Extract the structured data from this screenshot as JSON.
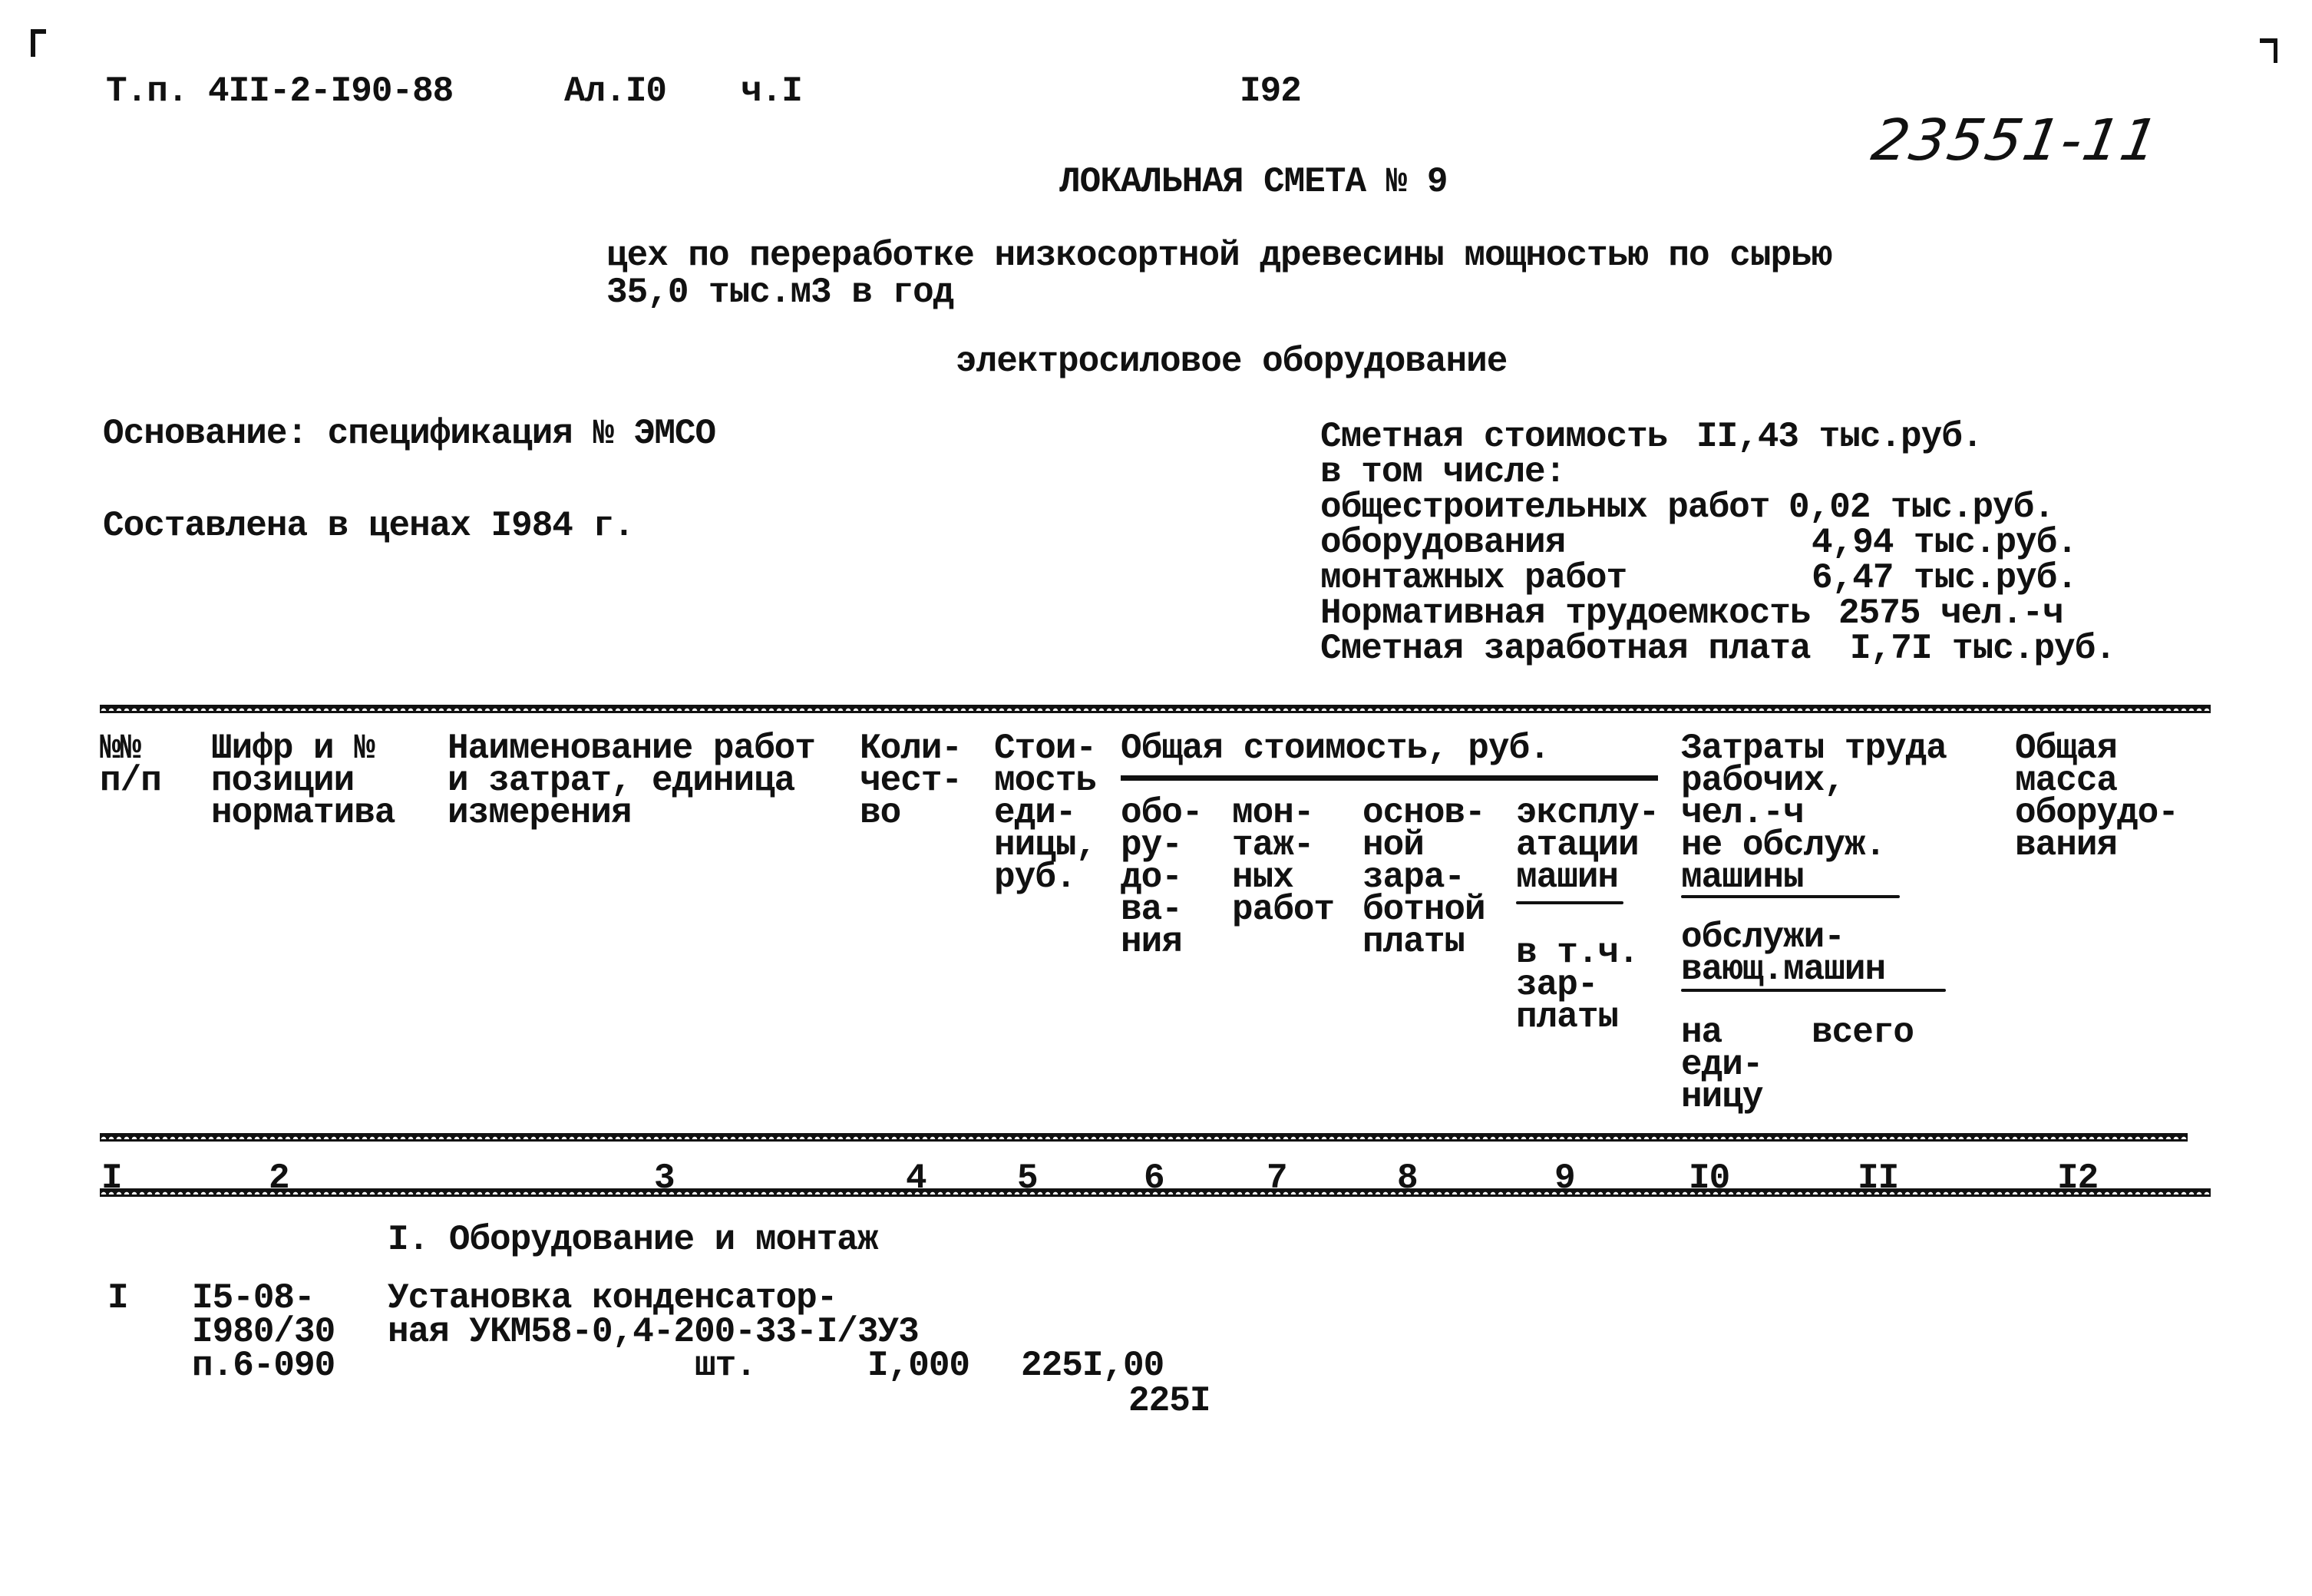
{
  "header": {
    "project_code": "Т.п. 4II-2-I90-88",
    "album": "Ал.I0",
    "part": "ч.I",
    "page_number": "I92",
    "stamp_number": "23551-11",
    "title": "ЛОКАЛЬНАЯ СМЕТА № 9",
    "object_line1": "цех по переработке низкосортной древесины мощностью по сырью",
    "object_line2": "35,0 тыс.м3 в год",
    "subtitle": "электросиловое оборудование"
  },
  "basis": {
    "basis_text": "Основание: спецификация № ЭМСО",
    "prices_text": "Составлена в ценах I984 г."
  },
  "summary": {
    "total_label": "Сметная стоимость",
    "total_value": "II,43 тыс.руб.",
    "including_label": "в том числе:",
    "rows": [
      {
        "label": "общестроительных работ",
        "value": "0,02 тыс.руб."
      },
      {
        "label": "оборудования",
        "value": "4,94 тыс.руб."
      },
      {
        "label": "монтажных работ",
        "value": "6,47 тыс.руб."
      }
    ],
    "labor_label": "Нормативная трудоемкость",
    "labor_value": "2575 чел.-ч",
    "wage_label": "Сметная заработная плата",
    "wage_value": "I,7I тыс.руб."
  },
  "table": {
    "headers": {
      "c1": [
        "№№",
        "п/п"
      ],
      "c2": [
        "Шифр и №",
        "позиции",
        "норматива"
      ],
      "c3": [
        "Наименование работ",
        "и затрат, единица",
        "измерения"
      ],
      "c4": [
        "Коли-",
        "чест-",
        "во"
      ],
      "c5": [
        "Стои-",
        "мость",
        "еди-",
        "ницы,",
        "руб."
      ],
      "group_total": "Общая стоимость, руб.",
      "c6": [
        "обо-",
        "ру-",
        "до-",
        "ва-",
        "ния"
      ],
      "c7": [
        "мон-",
        "таж-",
        "ных",
        "работ"
      ],
      "c8": [
        "основ-",
        "ной",
        "зара-",
        "ботной",
        "платы"
      ],
      "c9_top": [
        "эксплу-",
        "атации",
        "машин"
      ],
      "c9_bottom": [
        "в т.ч.",
        "зар-",
        "платы"
      ],
      "group_labor": [
        "Затраты труда",
        "рабочих,",
        "чел.-ч"
      ],
      "labor_sub1": [
        "не обслуж.",
        "машины"
      ],
      "labor_sub2": [
        "обслужи-",
        "вающ.машин"
      ],
      "c10": [
        "на",
        "еди-",
        "ницу"
      ],
      "c11": "всего",
      "c12": [
        "Общая",
        "масса",
        "оборудо-",
        "вания"
      ]
    },
    "column_numbers": [
      "I",
      "2",
      "3",
      "4",
      "5",
      "6",
      "7",
      "8",
      "9",
      "I0",
      "II",
      "I2"
    ],
    "section_title": "I. Оборудование и монтаж",
    "rows": [
      {
        "num": "I",
        "code": [
          "I5-08-",
          "I980/30",
          "п.6-090"
        ],
        "name": [
          "Установка конденсатор-",
          "ная УКМ58-0,4-200-33-I/3У3"
        ],
        "unit": "шт.",
        "quantity": "I,000",
        "unit_cost": "225I,00",
        "equipment_total": "225I"
      }
    ]
  }
}
